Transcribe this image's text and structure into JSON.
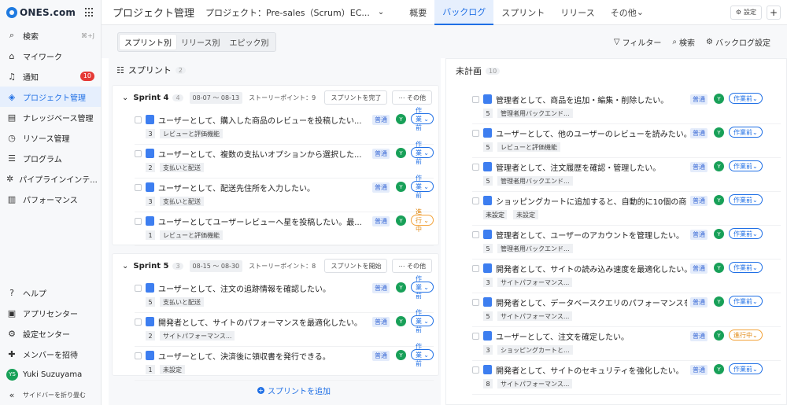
{
  "sidebar": {
    "logo": "ONES.com",
    "items": [
      {
        "label": "検索",
        "icon": "search-icon",
        "kbd": "⌘+J"
      },
      {
        "label": "マイワーク",
        "icon": "home-icon"
      },
      {
        "label": "通知",
        "icon": "bell-icon",
        "badge": "10"
      },
      {
        "label": "プロジェクト管理",
        "icon": "project-icon",
        "active": true
      },
      {
        "label": "ナレッジベース管理",
        "icon": "book-icon"
      },
      {
        "label": "リソース管理",
        "icon": "clock-icon"
      },
      {
        "label": "プログラム",
        "icon": "program-icon"
      },
      {
        "label": "パイプラインインテ...",
        "icon": "pipeline-icon"
      },
      {
        "label": "パフォーマンス",
        "icon": "chart-icon"
      }
    ],
    "bottom": [
      {
        "label": "ヘルプ",
        "icon": "help-icon"
      },
      {
        "label": "アプリセンター",
        "icon": "app-icon"
      },
      {
        "label": "設定センター",
        "icon": "settings-icon"
      },
      {
        "label": "メンバーを招待",
        "icon": "invite-icon"
      }
    ],
    "user": {
      "initials": "YS",
      "name": "Yuki Suzuyama"
    },
    "collapse_label": "サイドバーを折り畳む"
  },
  "header": {
    "title": "プロジェクト管理",
    "project": "プロジェクト：Pre-sales（Scrum）EC...",
    "tabs": [
      "概要",
      "バックログ",
      "スプリント",
      "リリース",
      "その他"
    ],
    "active_tab": 1,
    "settings_label": "設定"
  },
  "toolbar": {
    "views": [
      "スプリント別",
      "リリース別",
      "エピック別"
    ],
    "filter": "フィルター",
    "search": "検索",
    "backlog_settings": "バックログ設定"
  },
  "left": {
    "title": "スプリント",
    "count": "2",
    "sprints": [
      {
        "name": "Sprint 4",
        "count": "4",
        "dates": "08-07 〜 08-13",
        "points": "ストーリーポイント：9",
        "action": "スプリントを完了",
        "more": "⋯ その他",
        "rows": [
          {
            "title": "ユーザーとして、購入した商品のレビューを投稿したい...",
            "pts": "3",
            "tag": "レビューと評価機能",
            "pri": "普通",
            "user": "Y",
            "status": "作業前"
          },
          {
            "title": "ユーザーとして、複数の支払いオプションから選択した...",
            "pts": "2",
            "tag": "支払いと配送",
            "pri": "普通",
            "user": "Y",
            "status": "作業前"
          },
          {
            "title": "ユーザーとして、配送先住所を入力したい。",
            "pts": "3",
            "tag": "支払いと配送",
            "pri": "普通",
            "user": "Y",
            "status": "作業前"
          },
          {
            "title": "ユーザーとしてユーザーレビューへ星を投稿したい。最...",
            "pts": "1",
            "tag": "レビューと評価機能",
            "pri": "普通",
            "user": "Y",
            "status": "進行中"
          }
        ]
      },
      {
        "name": "Sprint 5",
        "count": "3",
        "dates": "08-15 〜 08-30",
        "points": "ストーリーポイント：8",
        "action": "スプリントを開始",
        "more": "⋯ その他",
        "rows": [
          {
            "title": "ユーザーとして、注文の追跡情報を確認したい。",
            "pts": "5",
            "tag": "支払いと配送",
            "pri": "普通",
            "user": "Y",
            "status": "作業前"
          },
          {
            "title": "開発者として、サイトのパフォーマンスを最適化したい。",
            "pts": "2",
            "tag": "サイトパフォーマンス...",
            "pri": "普通",
            "user": "Y",
            "status": "作業前"
          },
          {
            "title": "ユーザーとして、決済後に領収書を発行できる。",
            "pts": "1",
            "tag": "未設定",
            "pri": "普通",
            "user": "Y",
            "status": "作業前"
          }
        ]
      }
    ],
    "add_sprint": "スプリントを追加"
  },
  "right": {
    "title": "未計画",
    "count": "10",
    "rows": [
      {
        "title": "管理者として、商品を追加・編集・削除したい。",
        "pts": "5",
        "tag": "管理者用バックエンド...",
        "pri": "普通",
        "user": "Y",
        "status": "作業前"
      },
      {
        "title": "ユーザーとして、他のユーザーのレビューを読みたい。",
        "pts": "5",
        "tag": "レビューと評価機能",
        "pri": "普通",
        "user": "Y",
        "status": "作業前"
      },
      {
        "title": "管理者として、注文履歴を確認・管理したい。",
        "pts": "5",
        "tag": "管理者用バックエンド...",
        "pri": "普通",
        "user": "Y",
        "status": "作業前"
      },
      {
        "title": "ショッピングカートに追加すると、自動的に10個の商...",
        "pts": "未設定",
        "tag": "未設定",
        "pri": "普通",
        "user": "Y",
        "status": "作業前",
        "code": true
      },
      {
        "title": "管理者として、ユーザーのアカウントを管理したい。",
        "pts": "5",
        "tag": "管理者用バックエンド...",
        "pri": "普通",
        "user": "Y",
        "status": "作業前"
      },
      {
        "title": "開発者として、サイトの読み込み速度を最適化したい。",
        "pts": "3",
        "tag": "サイトパフォーマンス...",
        "pri": "普通",
        "user": "Y",
        "status": "作業前"
      },
      {
        "title": "開発者として、データベースクエリのパフォーマンスを...",
        "pts": "5",
        "tag": "サイトパフォーマンス...",
        "pri": "普通",
        "user": "Y",
        "status": "作業前"
      },
      {
        "title": "ユーザーとして、注文を確定したい。",
        "pts": "3",
        "tag": "ショッピングカートと...",
        "pri": "普通",
        "user": "Y",
        "status": "進行中"
      },
      {
        "title": "開発者として、サイトのセキュリティを強化したい。",
        "pts": "8",
        "tag": "サイトパフォーマンス...",
        "pri": "普通",
        "user": "Y",
        "status": "作業前"
      }
    ]
  },
  "colors": {
    "accent": "#1f6fe5",
    "progress": "#e08a16",
    "avatar": "#18a058"
  }
}
